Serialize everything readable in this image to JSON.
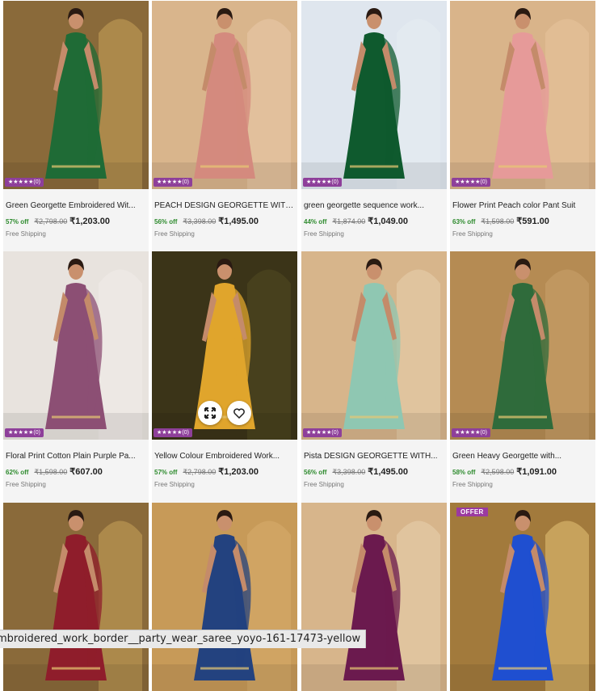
{
  "products": [
    {
      "title": "Green Georgette Embroidered Wit...",
      "discount": "57% off",
      "mrp": "₹2,798.00",
      "price": "₹1,203.00",
      "shipping": "Free Shipping",
      "rating": "★★★★★(0)",
      "colors": {
        "bg": "#8a6a3a",
        "garment": "#1f6b36",
        "accent": "#c9a35a"
      }
    },
    {
      "title": "PEACH DESIGN GEORGETTE WITH...",
      "discount": "56% off",
      "mrp": "₹3,398.00",
      "price": "₹1,495.00",
      "shipping": "Free Shipping",
      "rating": "★★★★★(0)",
      "colors": {
        "bg": "#d9b58c",
        "garment": "#d48a7e",
        "accent": "#e9c9a9"
      }
    },
    {
      "title": "green georgette sequence work...",
      "discount": "44% off",
      "mrp": "₹1,874.00",
      "price": "₹1,049.00",
      "shipping": "Free Shipping",
      "rating": "★★★★★(0)",
      "colors": {
        "bg": "#dfe6ee",
        "garment": "#0f5a2e",
        "accent": "#e6edf3"
      }
    },
    {
      "title": "Flower Print Peach color Pant Suit",
      "discount": "63% off",
      "mrp": "₹1,598.00",
      "price": "₹591.00",
      "shipping": "Free Shipping",
      "rating": "★★★★★(0)",
      "colors": {
        "bg": "#d9b48a",
        "garment": "#e69a99",
        "accent": "#e8c49c"
      }
    },
    {
      "title": "Floral Print Cotton Plain Purple Pa...",
      "discount": "62% off",
      "mrp": "₹1,598.00",
      "price": "₹607.00",
      "shipping": "Free Shipping",
      "rating": "★★★★★(0)",
      "colors": {
        "bg": "#e8e3de",
        "garment": "#8c4f74",
        "accent": "#f1ede9"
      }
    },
    {
      "title": "Yellow Colour Embroidered Work...",
      "discount": "57% off",
      "mrp": "₹2,798.00",
      "price": "₹1,203.00",
      "shipping": "Free Shipping",
      "rating": "★★★★★(0)",
      "colors": {
        "bg": "#3b3418",
        "garment": "#e0a52c",
        "accent": "#524a22"
      }
    },
    {
      "title": "Pista DESIGN GEORGETTE WITH...",
      "discount": "56% off",
      "mrp": "₹3,398.00",
      "price": "₹1,495.00",
      "shipping": "Free Shipping",
      "rating": "★★★★★(0)",
      "colors": {
        "bg": "#d7b58b",
        "garment": "#8fc7b2",
        "accent": "#e8cfae"
      }
    },
    {
      "title": "Green Heavy Georgette with...",
      "discount": "58% off",
      "mrp": "₹2,598.00",
      "price": "₹1,091.00",
      "shipping": "Free Shipping",
      "rating": "★★★★★(0)",
      "colors": {
        "bg": "#b58b53",
        "garment": "#2f6b3b",
        "accent": "#c9a26b"
      }
    },
    {
      "colors": {
        "bg": "#8a6a3a",
        "garment": "#8f1d2b",
        "accent": "#c9a35a"
      }
    },
    {
      "colors": {
        "bg": "#c79a58",
        "garment": "#23427f",
        "accent": "#d7ad6e"
      }
    },
    {
      "colors": {
        "bg": "#d7b58b",
        "garment": "#6b1a4e",
        "accent": "#e8cfae"
      }
    },
    {
      "offer": "OFFER",
      "colors": {
        "bg": "#a27a3c",
        "garment": "#1f4fd0",
        "accent": "#e6c277"
      }
    }
  ],
  "hover_actions": {
    "expand_icon": "expand-icon",
    "wishlist_icon": "heart-icon"
  },
  "status_url": "mbroidered_work_border__party_wear_saree_yoyo-161-17473-yellow"
}
